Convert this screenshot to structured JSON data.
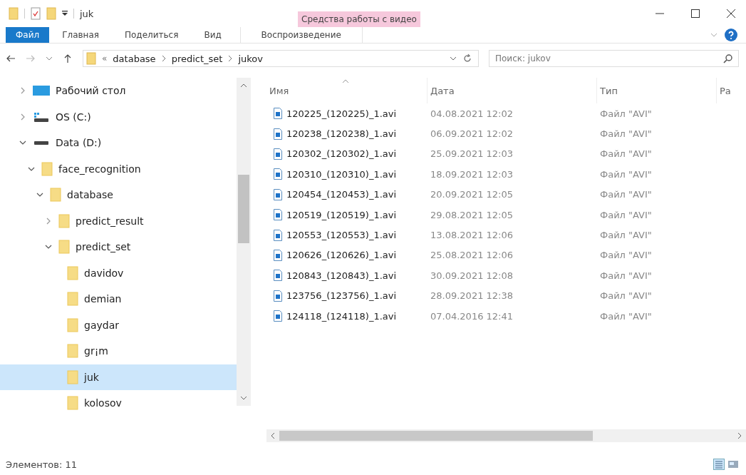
{
  "window": {
    "title": "juk"
  },
  "ribbon": {
    "context_group": "Средства работы с видео",
    "tabs": [
      {
        "label": "Файл",
        "kind": "file",
        "selected": false
      },
      {
        "label": "Главная",
        "kind": "tab",
        "selected": false
      },
      {
        "label": "Поделиться",
        "kind": "tab",
        "selected": false
      },
      {
        "label": "Вид",
        "kind": "tab",
        "selected": false
      },
      {
        "label": "Воспроизведение",
        "kind": "context",
        "selected": false
      }
    ]
  },
  "address": {
    "overflow": "«",
    "crumbs": [
      "database",
      "predict_set",
      "jukov"
    ]
  },
  "search": {
    "placeholder": "Поиск: jukov"
  },
  "tree": [
    {
      "label": "Рабочий стол",
      "kind": "desktop",
      "expandable": true,
      "expanded": false,
      "selected": false
    },
    {
      "label": "OS (C:)",
      "kind": "system-drive",
      "expandable": true,
      "expanded": false,
      "selected": false
    },
    {
      "label": "Data (D:)",
      "kind": "drive",
      "expandable": true,
      "expanded": true,
      "selected": false,
      "children": [
        {
          "label": "face_recognition",
          "kind": "folder",
          "expandable": true,
          "expanded": true,
          "selected": false,
          "children": [
            {
              "label": "database",
              "kind": "folder",
              "expandable": true,
              "expanded": true,
              "selected": false,
              "children": [
                {
                  "label": "predict_result",
                  "kind": "folder",
                  "expandable": true,
                  "expanded": false,
                  "selected": false
                },
                {
                  "label": "predict_set",
                  "kind": "folder",
                  "expandable": true,
                  "expanded": true,
                  "selected": false,
                  "children": [
                    {
                      "label": "davidov",
                      "kind": "folder",
                      "expandable": false,
                      "selected": false
                    },
                    {
                      "label": "demian",
                      "kind": "folder",
                      "expandable": false,
                      "selected": false
                    },
                    {
                      "label": "gaydar",
                      "kind": "folder",
                      "expandable": false,
                      "selected": false
                    },
                    {
                      "label": "gr¡m",
                      "kind": "folder",
                      "expandable": false,
                      "selected": false
                    },
                    {
                      "label": "juk",
                      "kind": "folder",
                      "expandable": false,
                      "selected": true
                    },
                    {
                      "label": "kolosov",
                      "kind": "folder",
                      "expandable": false,
                      "selected": false
                    }
                  ]
                }
              ]
            }
          ]
        }
      ]
    }
  ],
  "table": {
    "columns": [
      "Имя",
      "Дата",
      "Тип",
      "Ра"
    ],
    "rows": [
      {
        "name": "120225_(120225)_1.avi",
        "date": "04.08.2021 12:02",
        "type": "Файл \"AVI\""
      },
      {
        "name": "120238_(120238)_1.avi",
        "date": "06.09.2021 12:02",
        "type": "Файл \"AVI\""
      },
      {
        "name": "120302_(120302)_1.avi",
        "date": "25.09.2021 12:03",
        "type": "Файл \"AVI\""
      },
      {
        "name": "120310_(120310)_1.avi",
        "date": "18.09.2021 12:03",
        "type": "Файл \"AVI\""
      },
      {
        "name": "120454_(120453)_1.avi",
        "date": "20.09.2021 12:05",
        "type": "Файл \"AVI\""
      },
      {
        "name": "120519_(120519)_1.avi",
        "date": "29.08.2021 12:05",
        "type": "Файл \"AVI\""
      },
      {
        "name": "120553_(120553)_1.avi",
        "date": "13.08.2021 12:06",
        "type": "Файл \"AVI\""
      },
      {
        "name": "120626_(120626)_1.avi",
        "date": "25.08.2021 12:06",
        "type": "Файл \"AVI\""
      },
      {
        "name": "120843_(120843)_1.avi",
        "date": "30.09.2021 12:08",
        "type": "Файл \"AVI\""
      },
      {
        "name": "123756_(123756)_1.avi",
        "date": "28.09.2021 12:38",
        "type": "Файл \"AVI\""
      },
      {
        "name": "124118_(124118)_1.avi",
        "date": "07.04.2016 12:41",
        "type": "Файл \"AVI\""
      }
    ]
  },
  "status_bar": {
    "count": "Элементов: 11"
  }
}
